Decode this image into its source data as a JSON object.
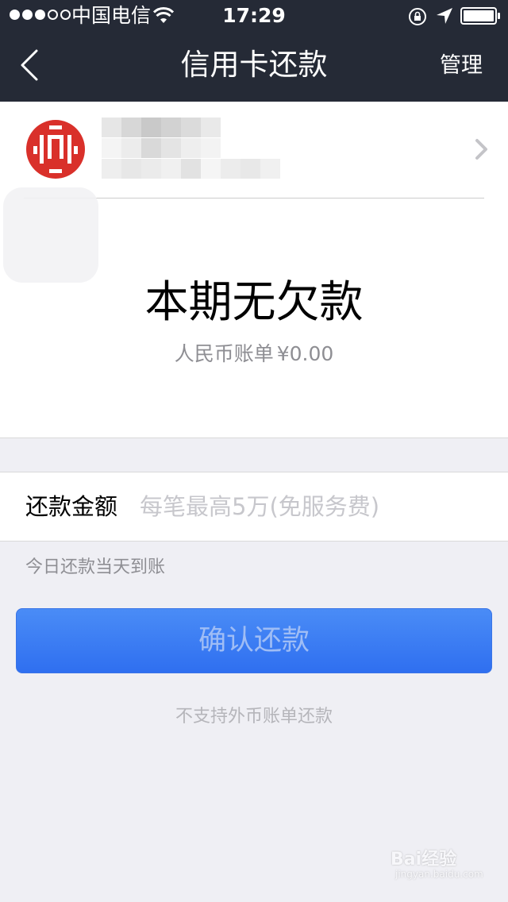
{
  "status_bar": {
    "carrier": "中国电信",
    "time": "17:29",
    "signal_bars_filled": 3,
    "signal_bars_total": 5
  },
  "nav": {
    "title": "信用卡还款",
    "action_label": "管理"
  },
  "card": {
    "bank_logo": "citic-bank-logo-icon",
    "details_redacted": true,
    "status_title": "本期无欠款",
    "bill_label": "人民币账单",
    "bill_amount": "¥0.00"
  },
  "repayment": {
    "amount_label": "还款金额",
    "amount_placeholder": "每笔最高5万(免服务费)",
    "amount_value": "",
    "arrival_hint": "今日还款当天到账",
    "confirm_label": "确认还款",
    "foreign_notice": "不支持外币账单还款"
  },
  "watermark": {
    "main": "Bai经验",
    "sub": "jingyan.baidu.com"
  },
  "colors": {
    "nav_background": "#252a36",
    "page_background": "#efeff4",
    "button_primary": "#3a7df3",
    "bank_red": "#d9302a"
  }
}
